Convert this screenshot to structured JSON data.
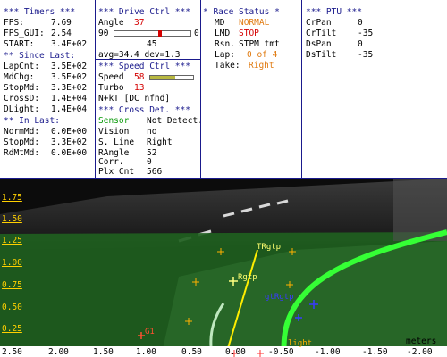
{
  "timers": {
    "header": "*** Timers ***",
    "rows": [
      {
        "label": "FPS:",
        "value": "7.69"
      },
      {
        "label": "FPS_GUI:",
        "value": "2.54"
      },
      {
        "label": "START:",
        "value": "3.4E+02"
      }
    ],
    "since_header": "** Since Last:",
    "since_rows": [
      {
        "label": "LapCnt:",
        "value": "3.5E+02"
      },
      {
        "label": "MdChg:",
        "value": "3.5E+02"
      },
      {
        "label": "StopMd:",
        "value": "3.3E+02"
      },
      {
        "label": "CrossD:",
        "value": "1.4E+04"
      },
      {
        "label": "DLight:",
        "value": "1.4E+04"
      }
    ],
    "in_header": "** In Last:",
    "in_rows": [
      {
        "label": "NormMd:",
        "value": "0.0E+00"
      },
      {
        "label": "StopMd:",
        "value": "3.3E+02"
      },
      {
        "label": "RdMtMd:",
        "value": "0.0E+00"
      }
    ]
  },
  "drive": {
    "header": "***  Drive Ctrl  ***",
    "angle_label": "Angle",
    "angle_value": "37",
    "slider_left": "90",
    "slider_right": "0",
    "slider_center": "45",
    "slider_level": 0.6,
    "avg_text": "avg=34.4  dev=1.3",
    "speed_header": "***  Speed Ctrl  ***",
    "speed_label": "Speed",
    "speed_value": "58",
    "speed_level": 0.58,
    "turbo_label": "Turbo",
    "turbo_value": "13",
    "nkt_text": "N+kT [DC nfnd]",
    "cross_header": "*** Cross Det. ***",
    "cross_rows": [
      {
        "label": "Sensor",
        "value": "Not Detect."
      },
      {
        "label": "Vision",
        "value": "no"
      },
      {
        "label": "S. Line",
        "value": "Right"
      },
      {
        "label": "RAngle",
        "value": "52"
      },
      {
        "label": "Corr.",
        "value": "0"
      },
      {
        "label": "Plx Cnt",
        "value": "566"
      }
    ]
  },
  "race": {
    "header": "* Race Status *",
    "rows": [
      {
        "label": "MD",
        "value": "NORMAL"
      },
      {
        "label": "LMD",
        "value": "STOP"
      },
      {
        "label": "Rsn.",
        "value": "STPM tmt"
      },
      {
        "label": "Lap:",
        "value": "0 of 4"
      },
      {
        "label": "Take:",
        "value": "Right"
      }
    ]
  },
  "ptu": {
    "header": "*** PTU ***",
    "rows": [
      {
        "label": "CrPan",
        "value": "0"
      },
      {
        "label": "CrTilt",
        "value": "-35"
      },
      {
        "label": "DsPan",
        "value": "0"
      },
      {
        "label": "DsTilt",
        "value": "-35"
      }
    ]
  },
  "view": {
    "y_ticks": [
      "1.75",
      "1.50",
      "1.25",
      "1.00",
      "0.75",
      "0.50",
      "0.25"
    ],
    "x_ticks": [
      "2.50",
      "2.00",
      "1.50",
      "1.00",
      "0.50",
      "0.00",
      "-0.50",
      "-1.00",
      "-1.50",
      "-2.00"
    ],
    "unit_label": "meters",
    "marker_labels": {
      "target": "TRgtp",
      "right_point": "Rgtp",
      "left_point": "gtRgtp",
      "g1": "G1",
      "light": "light"
    }
  },
  "colors": {
    "section_header": "#1a1a8c",
    "accent_red": "#d40000",
    "accent_orange": "#e07a10",
    "sensor_green": "#0a9a0a",
    "axis_yellow": "#ffd000",
    "lane_green": "#35ff35"
  }
}
